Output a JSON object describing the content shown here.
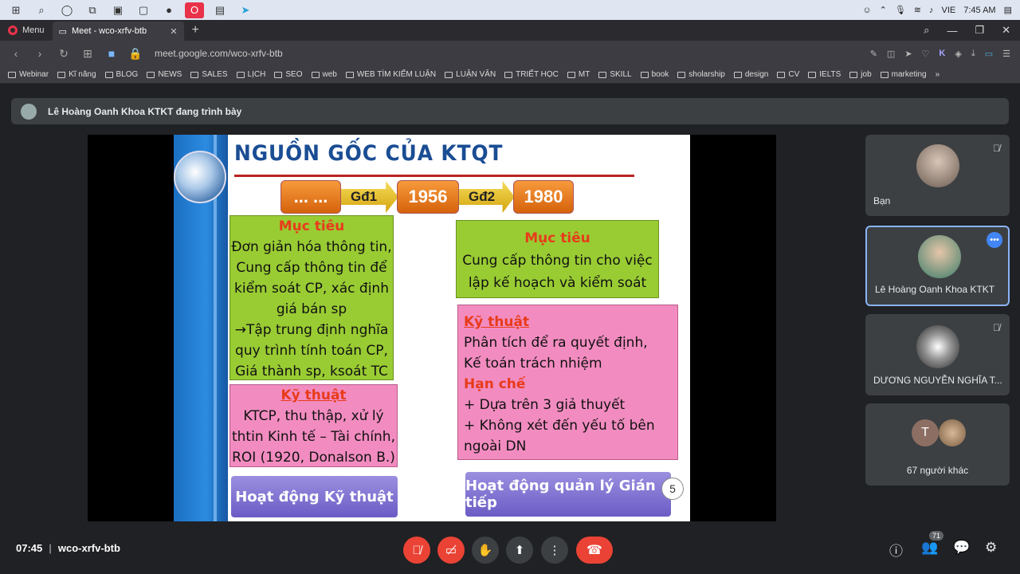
{
  "taskbar": {
    "lang": "VIE",
    "time": "7:45 AM"
  },
  "browser": {
    "menu_label": "Menu",
    "tab_title": "Meet - wco-xrfv-btb",
    "url": "meet.google.com/wco-xrfv-btb",
    "bookmarks": [
      "Webinar",
      "Kĩ năng",
      "BLOG",
      "NEWS",
      "SALES",
      "LỊCH",
      "SEO",
      "web",
      "WEB TÌM KIẾM LUẬN",
      "LUẬN VĂN",
      "TRIẾT HỌC",
      "MT",
      "SKILL",
      "book",
      "sholarship",
      "design",
      "CV",
      "IELTS",
      "job",
      "marketing"
    ]
  },
  "banner": {
    "text": "Lê Hoàng Oanh Khoa KTKT đang trình bày"
  },
  "slide": {
    "title": "NGUỒN GỐC CỦA KTQT",
    "timeline": {
      "start": "... ...",
      "phase1": "Gđ1",
      "year1": "1956",
      "phase2": "Gđ2",
      "year2": "1980"
    },
    "box1": {
      "heading": "Mục tiêu",
      "lines": [
        "Đơn giản hóa thông tin,",
        "Cung cấp thông tin để",
        "kiểm soát CP, xác định",
        "giá bán sp",
        "→Tập trung định nghĩa",
        "quy trình tính toán CP,",
        "Giá thành sp, ksoát TC"
      ]
    },
    "box2": {
      "heading": "Kỹ thuật",
      "lines": [
        "KTCP, thu thập, xử lý",
        "thtin Kinh tế – Tài chính,",
        "ROI (1920, Donalson B.)"
      ]
    },
    "box3": {
      "heading": "Mục tiêu",
      "lines": [
        "Cung cấp thông tin cho việc",
        "lập kế hoạch và kiểm soát"
      ]
    },
    "box4": {
      "heading1": "Kỹ thuật",
      "lines1": [
        "Phân tích để ra quyết định,",
        "Kế toán trách nhiệm"
      ],
      "heading2": "Hạn chế",
      "lines2": [
        "+ Dựa trên 3 giả thuyết",
        "+ Không xét đến yếu tố bên",
        "ngoài DN"
      ]
    },
    "scroll1": "Hoạt động Kỹ thuật",
    "scroll2": "Hoạt động quản lý Gián tiếp",
    "page_number": "5"
  },
  "participants": [
    {
      "name": "Bạn",
      "muted": true
    },
    {
      "name": "Lê Hoàng Oanh Khoa KTKT",
      "muted": false
    },
    {
      "name": "DƯƠNG NGUYỄN NGHĨA T...",
      "muted": true
    },
    {
      "name": "67 người khác",
      "initial": "T"
    }
  ],
  "bottom": {
    "time": "07:45",
    "meeting_code": "wco-xrfv-btb",
    "people_count": "71"
  }
}
